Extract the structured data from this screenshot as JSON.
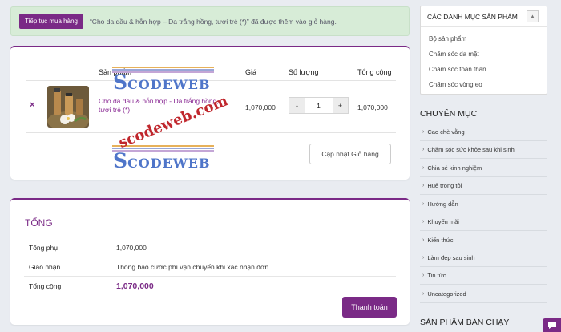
{
  "notice": {
    "button_label": "Tiếp tục mua hàng",
    "message": "“Cho da dầu & hỗn hợp – Da trắng hồng, tươi trẻ (*)” đã được thêm vào giỏ hàng."
  },
  "cart": {
    "headers": {
      "product": "Sản phẩm",
      "price": "Giá",
      "quantity": "Số lượng",
      "total": "Tổng cộng"
    },
    "item": {
      "remove_icon": "×",
      "name": "Cho da dầu & hỗn hợp - Da trắng hồng, tươi trẻ (*)",
      "price": "1,070,000",
      "quantity": "1",
      "subtotal": "1,070,000"
    },
    "qty_minus": "-",
    "qty_plus": "+",
    "update_label": "Cập nhật Giỏ hàng"
  },
  "watermark": {
    "letter": "S",
    "rest": "CODEWEB",
    "diagonal": "scodeweb.com"
  },
  "totals": {
    "title": "TỔNG",
    "rows": [
      {
        "label": "Tổng phụ",
        "value": "1,070,000"
      },
      {
        "label": "Giao nhận",
        "value": "Thông báo cước phí vận chuyển khi xác nhận đơn"
      },
      {
        "label": "Tổng cộng",
        "value": "1,070,000"
      }
    ],
    "checkout_label": "Thanh toán"
  },
  "sidebar": {
    "product_categories": {
      "title": "CÁC DANH MỤC SẢN PHẨM",
      "toggle_icon": "▲",
      "items": [
        "Bộ sản phẩm",
        "Chăm sóc da mặt",
        "Chăm sóc toàn thân",
        "Chăm sóc vòng eo"
      ]
    },
    "categories": {
      "title": "CHUYÊN MỤC",
      "items": [
        "Cao chè vằng",
        "Chăm sóc sức khỏe sau khi sinh",
        "Chia sẻ kinh nghiệm",
        "Huế trong tôi",
        "Hướng dẫn",
        "Khuyến mãi",
        "Kiến thức",
        "Làm đẹp sau sinh",
        "Tin tức",
        "Uncategorized"
      ]
    },
    "best_sellers_title": "SẢN PHẨM BÁN CHẠY"
  },
  "colors": {
    "accent": "#7a2a86",
    "notice_bg": "#d7ecd7",
    "page_bg": "#e9ecf1"
  },
  "icons": {
    "remove": "close-icon",
    "toggle": "chevron-up-icon",
    "chat": "chat-icon",
    "category_arrow": "chevron-right-icon"
  }
}
